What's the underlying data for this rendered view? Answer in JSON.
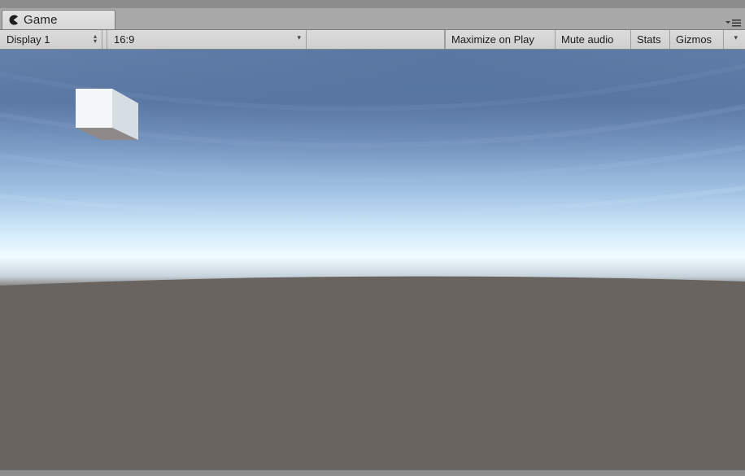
{
  "tab": {
    "title": "Game",
    "icon": "pacman-icon"
  },
  "tab_menu_icon": "tab-options-icon",
  "toolbar": {
    "display_select": "Display 1",
    "aspect_select": "16:9",
    "maximize_on_play": "Maximize on Play",
    "mute_audio": "Mute audio",
    "stats": "Stats",
    "gizmos": "Gizmos"
  },
  "scene": {
    "sky_top_color": "#5a7aa6",
    "horizon_color": "#eaf6ff",
    "ground_color": "#6a6461",
    "cube_color": "#f2f5f8"
  }
}
